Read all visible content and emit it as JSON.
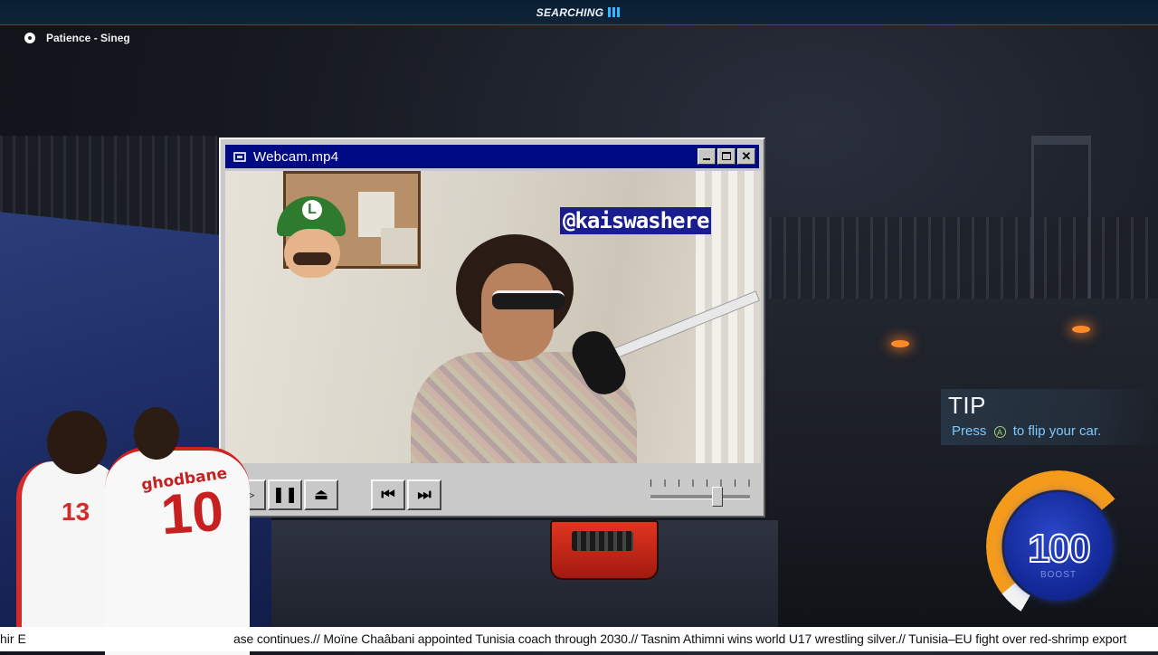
{
  "top_bar": {
    "status": "SEARCHING",
    "accent": "#36b7ff"
  },
  "now_playing": {
    "icon": "disc-icon",
    "track": "Patience - Sineg"
  },
  "player": {
    "title": "Webcam.mp4",
    "title_bar_color": "#000a84",
    "handle": "@kaiswashere",
    "controls": {
      "play": "▷",
      "pause": "❚❚",
      "eject": "⏏",
      "prev": "⏮",
      "next": "⏭"
    },
    "volume_level": 0.67,
    "window_buttons": {
      "close": "✕"
    }
  },
  "players_overlay": {
    "left_number": "13",
    "right_name": "ghodbane",
    "right_number": "10"
  },
  "tip": {
    "title": "TIP",
    "text_before": "Press",
    "button_glyph": "A",
    "text_after": "to flip your car."
  },
  "boost": {
    "value": "100",
    "label": "BOOST",
    "fill_fraction": 1.0
  },
  "ticker": {
    "left_fragment": "hir E",
    "text": "ase continues.// Moïne Chaâbani appointed Tunisia coach through 2030.// Tasnim Athimni wins world U17 wrestling silver.// Tunisia–EU fight over red-shrimp export"
  }
}
